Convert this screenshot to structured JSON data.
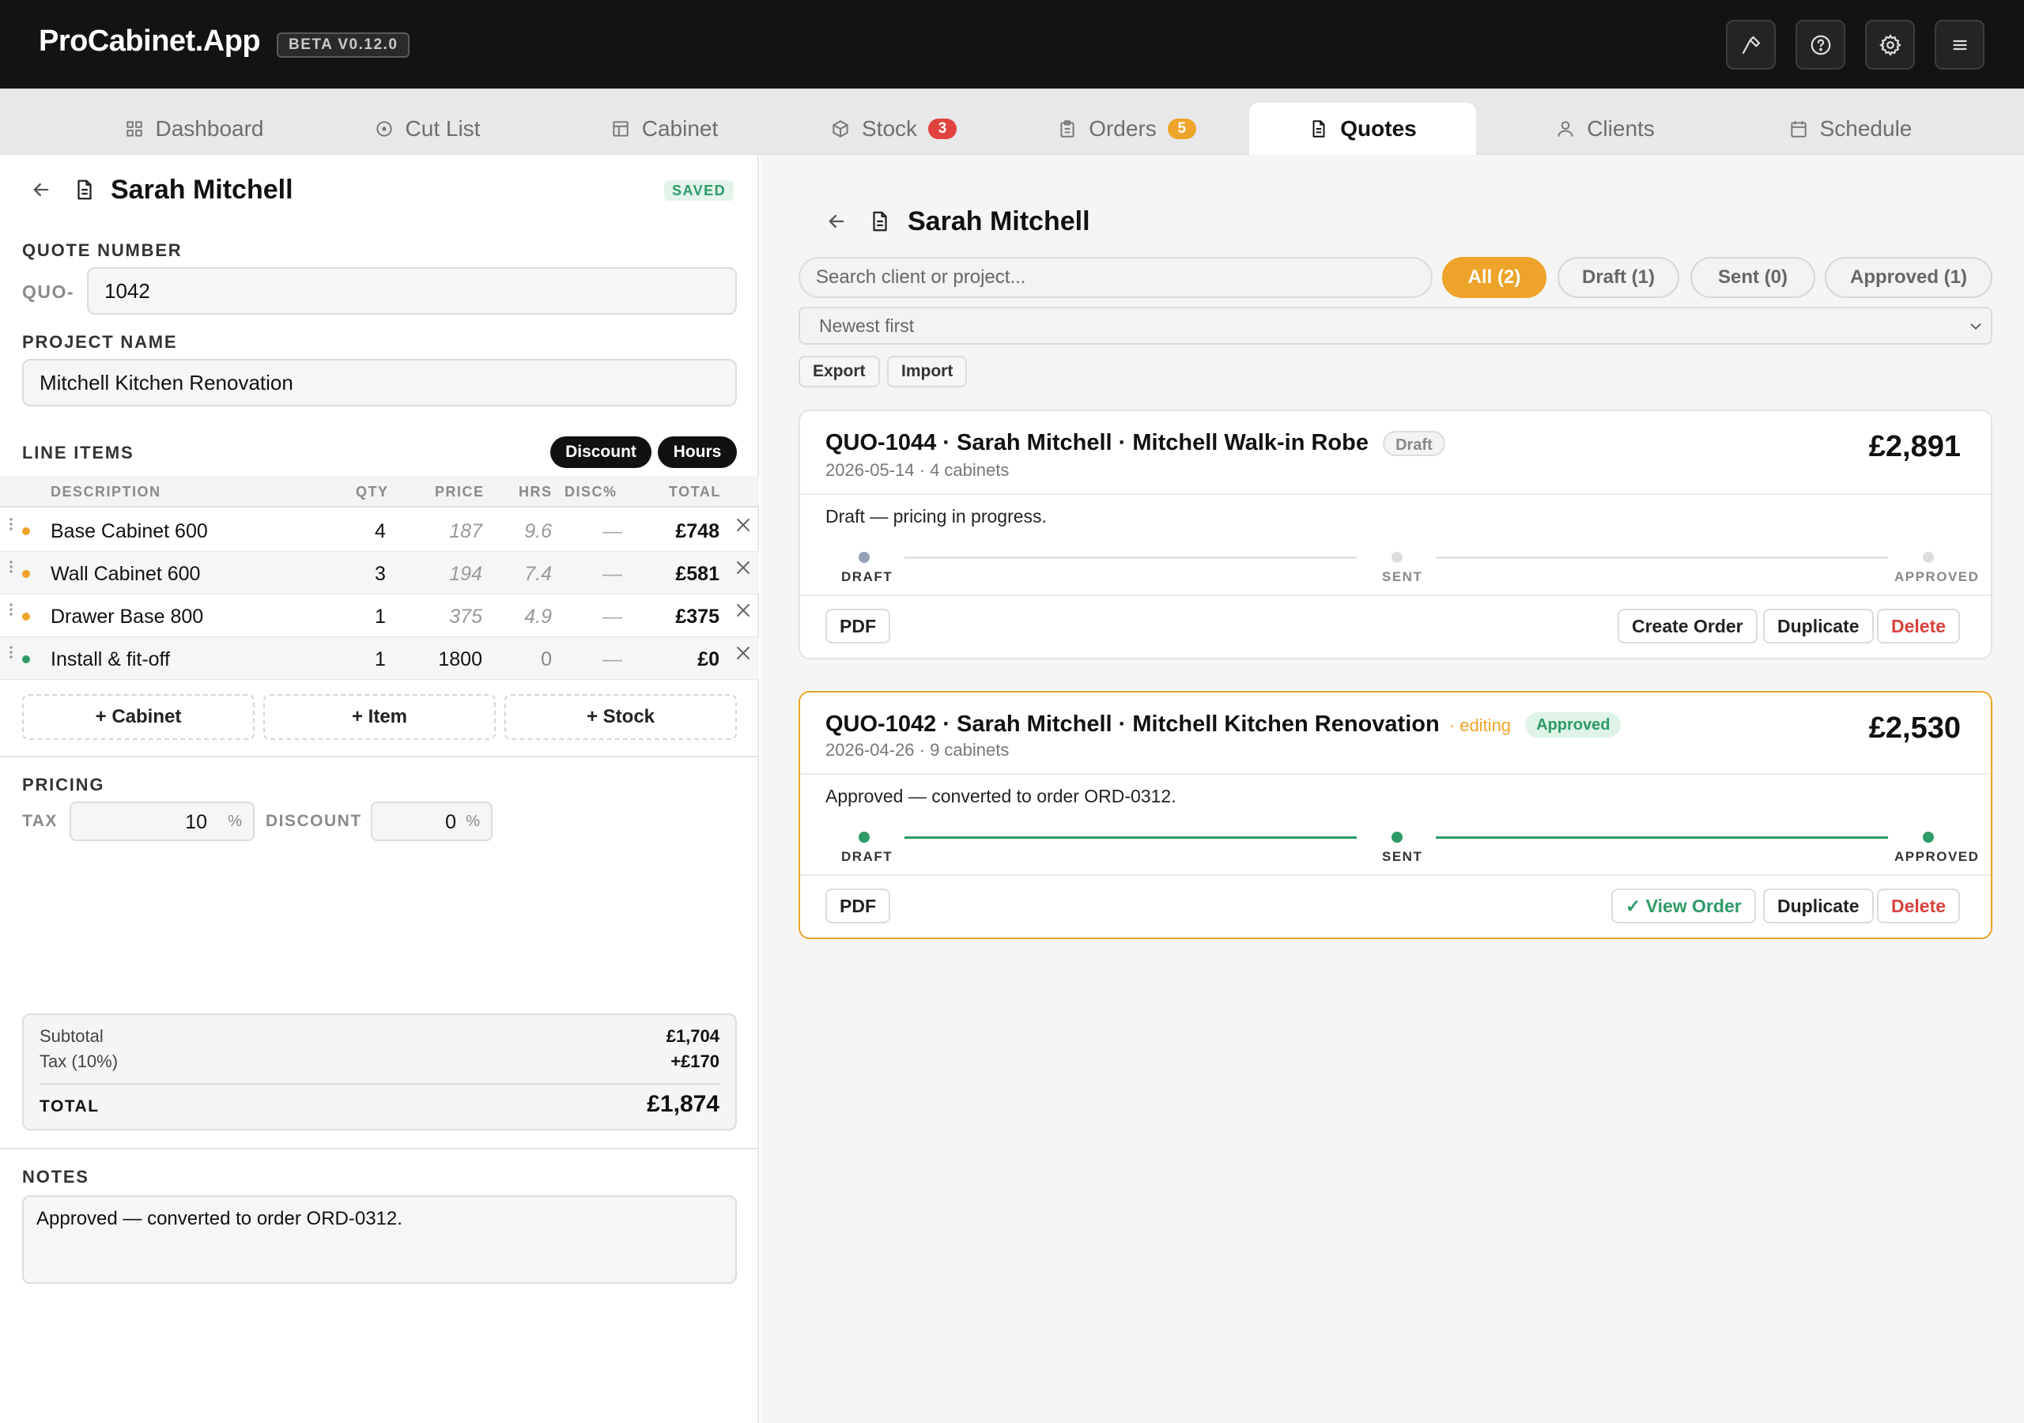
{
  "app": {
    "name": "ProCabinet.App",
    "version": "BETA V0.12.0"
  },
  "topbar": {
    "icons": [
      "hammer-icon",
      "help-icon",
      "gear-icon",
      "menu-icon"
    ]
  },
  "tabs": [
    {
      "label": "Dashboard",
      "icon": "grid-icon"
    },
    {
      "label": "Cut List",
      "icon": "saw-icon"
    },
    {
      "label": "Cabinet",
      "icon": "cabinet-icon"
    },
    {
      "label": "Stock",
      "icon": "box-icon",
      "count": "3",
      "count_color": "#e0433f"
    },
    {
      "label": "Orders",
      "icon": "clipboard-icon",
      "count": "5",
      "count_color": "#eea42a"
    },
    {
      "label": "Quotes",
      "icon": "document-icon",
      "active": true
    },
    {
      "label": "Clients",
      "icon": "user-icon"
    },
    {
      "label": "Schedule",
      "icon": "calendar-icon"
    }
  ],
  "editor": {
    "client": "Sarah Mitchell",
    "status": "SAVED",
    "quote_number_label": "QUOTE NUMBER",
    "quote_prefix": "QUO-",
    "quote_number": "1042",
    "project_name_label": "PROJECT NAME",
    "project_name": "Mitchell Kitchen Renovation",
    "line_items_label": "LINE ITEMS",
    "discount_toggle": "Discount",
    "hours_toggle": "Hours",
    "columns": [
      "DESCRIPTION",
      "QTY",
      "PRICE",
      "HRS",
      "DISC%",
      "TOTAL"
    ],
    "items": [
      {
        "desc": "Base Cabinet 600",
        "qty": "4",
        "price": "187",
        "hrs": "9.6",
        "disc": "—",
        "total": "£748",
        "dot": "#eea42a"
      },
      {
        "desc": "Wall Cabinet 600",
        "qty": "3",
        "price": "194",
        "hrs": "7.4",
        "disc": "—",
        "total": "£581",
        "dot": "#eea42a"
      },
      {
        "desc": "Drawer Base 800",
        "qty": "1",
        "price": "375",
        "hrs": "4.9",
        "disc": "—",
        "total": "£375",
        "dot": "#eea42a"
      },
      {
        "desc": "Install & fit-off",
        "qty": "1",
        "price": "1800",
        "hrs": "0",
        "disc": "—",
        "total": "£0",
        "dot": "#2e9a66"
      }
    ],
    "add_buttons": [
      "+ Cabinet",
      "+ Item",
      "+ Stock"
    ],
    "pricing_label": "PRICING",
    "tax_label": "TAX",
    "tax_value": "10",
    "discount_label": "DISCOUNT",
    "discount_value": "0",
    "pct": "%",
    "subtotal_label": "Subtotal",
    "subtotal": "£1,704",
    "tax_line_label": "Tax (10%)",
    "tax_amount": "+£170",
    "total_label": "TOTAL",
    "total": "£1,874",
    "notes_label": "NOTES",
    "notes": "Approved — converted to order ORD-0312."
  },
  "list": {
    "client": "Sarah Mitchell",
    "search_placeholder": "Search client or project...",
    "filters": [
      {
        "label": "All (2)",
        "active": true
      },
      {
        "label": "Draft (1)"
      },
      {
        "label": "Sent (0)"
      },
      {
        "label": "Approved (1)"
      }
    ],
    "sort": "Newest first",
    "export": "Export",
    "import": "Import",
    "stage_labels": [
      "DRAFT",
      "SENT",
      "APPROVED"
    ],
    "quotes": [
      {
        "title": "QUO-1044 · Sarah Mitchell · Mitchell Walk-in Robe",
        "editing": "",
        "status": "Draft",
        "meta": "2026-05-14 · 4 cabinets",
        "amount": "£2,891",
        "note": "Draft — pricing in progress.",
        "stage": 1,
        "buttons": [
          "PDF",
          "Create Order",
          "Duplicate",
          "Delete"
        ]
      },
      {
        "title": "QUO-1042 · Sarah Mitchell · Mitchell Kitchen Renovation",
        "editing": "· editing",
        "status": "Approved",
        "meta": "2026-04-26 · 9 cabinets",
        "amount": "£2,530",
        "note": "Approved — converted to order ORD-0312.",
        "stage": 3,
        "buttons": [
          "PDF",
          "✓ View Order",
          "Duplicate",
          "Delete"
        ]
      }
    ]
  },
  "colors": {
    "accent": "#eea42a",
    "success": "#2e9a66",
    "danger": "#d9423c"
  }
}
